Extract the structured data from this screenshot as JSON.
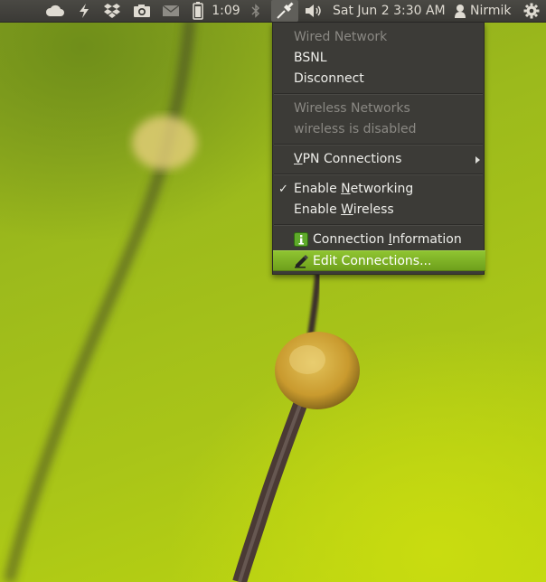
{
  "panel": {
    "battery_time": "1:09",
    "datetime": "Sat Jun  2  3:30 AM",
    "username": "Nirmik"
  },
  "menu": {
    "wired_header": "Wired Network",
    "wired_connection": "BSNL",
    "disconnect": "Disconnect",
    "wireless_header": "Wireless Networks",
    "wireless_status": "wireless is disabled",
    "vpn": {
      "pre": "",
      "u": "V",
      "post": "PN Connections"
    },
    "enable_networking": {
      "pre": "Enable ",
      "u": "N",
      "post": "etworking",
      "checked": true
    },
    "enable_wireless": {
      "pre": "Enable ",
      "u": "W",
      "post": "ireless",
      "checked": false
    },
    "connection_info": {
      "pre": "Connection ",
      "u": "I",
      "post": "nformation"
    },
    "edit_connections": "Edit Connections..."
  },
  "colors": {
    "panel_bg": "#3c3b37",
    "menu_bg": "#3c3b37",
    "highlight": "#7cb025",
    "wallpaper": "#a2bf1a"
  }
}
